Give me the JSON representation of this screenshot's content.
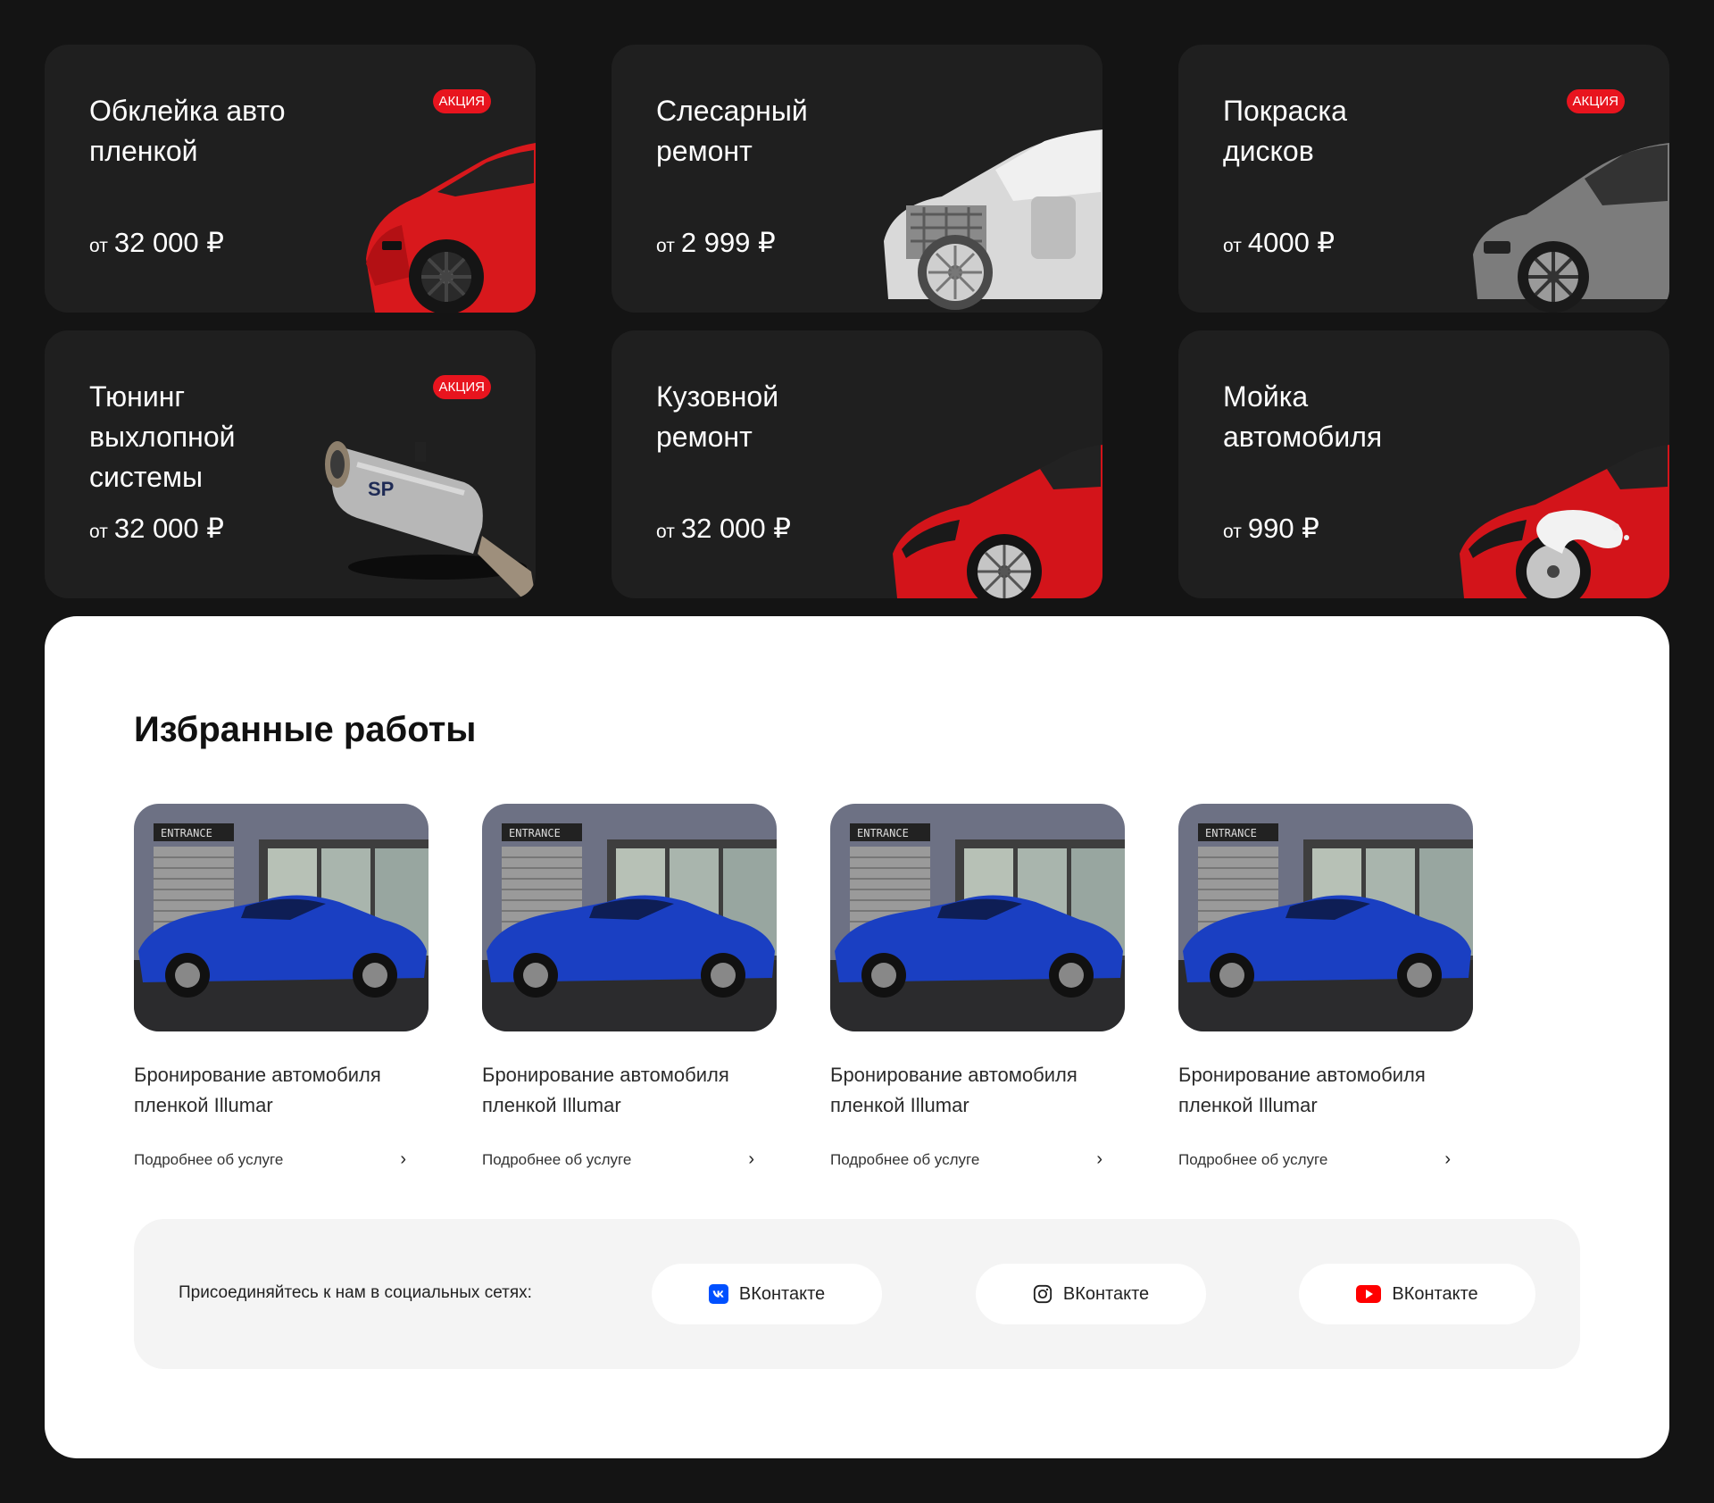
{
  "services": [
    {
      "title": "Обклейка авто\nпленкой",
      "from": "от",
      "price": "32 000 ₽",
      "badge": "АКЦИЯ"
    },
    {
      "title": "Слесарный\nремонт",
      "from": "от",
      "price": "2 999 ₽",
      "badge": ""
    },
    {
      "title": "Покраска\nдисков",
      "from": "от",
      "price": "4000 ₽",
      "badge": "АКЦИЯ"
    },
    {
      "title": "Тюнинг\nвыхлопной\nсистемы",
      "from": "от",
      "price": "32 000 ₽",
      "badge": "АКЦИЯ"
    },
    {
      "title": "Кузовной\nремонт",
      "from": "от",
      "price": "32 000 ₽",
      "badge": ""
    },
    {
      "title": "Мойка\nавтомобиля",
      "from": "от",
      "price": "990 ₽",
      "badge": ""
    }
  ],
  "works": {
    "title": "Избранные работы",
    "items": [
      {
        "caption": "Бронирование автомобиля пленкой Illumar",
        "more": "Подробнее об услуге",
        "sign": "ENTRANCE"
      },
      {
        "caption": "Бронирование автомобиля пленкой Illumar",
        "more": "Подробнее об услуге",
        "sign": "ENTRANCE"
      },
      {
        "caption": "Бронирование автомобиля пленкой Illumar",
        "more": "Подробнее об услуге",
        "sign": "ENTRANCE"
      },
      {
        "caption": "Бронирование автомобиля пленкой Illumar",
        "more": "Подробнее об услуге",
        "sign": "ENTRANCE"
      }
    ]
  },
  "social": {
    "label": "Присоединяйтесь к нам в социальных сетях:",
    "buttons": [
      {
        "label": "ВКонтакте",
        "icon": "vk-icon"
      },
      {
        "label": "ВКонтакте",
        "icon": "instagram-icon"
      },
      {
        "label": "ВКонтакте",
        "icon": "youtube-icon"
      }
    ]
  },
  "colors": {
    "accent": "#e8141e",
    "background": "#141414",
    "card": "#1f1f1f"
  }
}
